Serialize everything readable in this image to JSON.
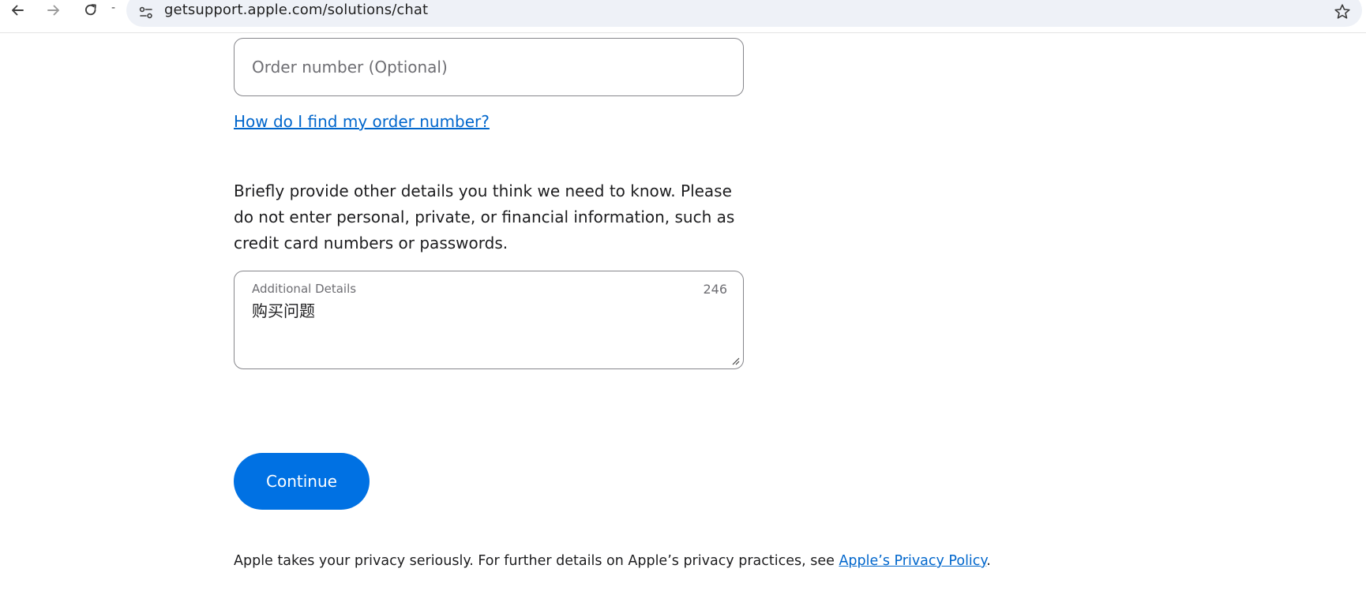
{
  "browser": {
    "url": "getsupport.apple.com/solutions/chat",
    "separator": "-"
  },
  "form": {
    "order_number_placeholder": "Order number (Optional)",
    "order_help_link": "How do I find my order number?",
    "instructions": "Briefly provide other details you think we need to know. Please do not enter personal, private, or financial information, such as credit card numbers or passwords.",
    "details_label": "Additional Details",
    "details_char_count": "246",
    "details_value": "购买问题",
    "continue_label": "Continue"
  },
  "footer": {
    "privacy_text": "Apple takes your privacy seriously. For further details on Apple’s privacy practices, see ",
    "privacy_link": "Apple’s Privacy Policy",
    "privacy_end": "."
  },
  "colors": {
    "accent": "#0071e3",
    "link": "#0066cc",
    "border": "#86868b",
    "omnibox": "#eef1f7"
  }
}
